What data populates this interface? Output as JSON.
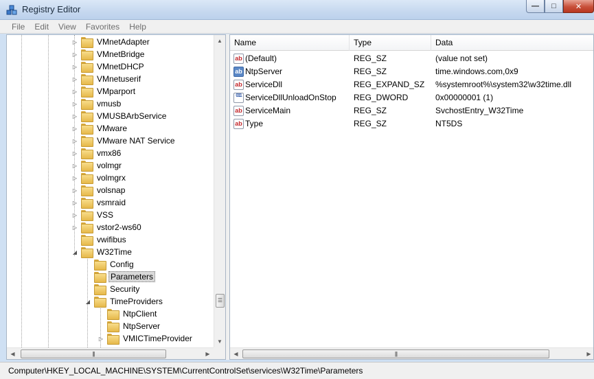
{
  "window": {
    "title": "Registry Editor",
    "buttons": {
      "minimize": "—",
      "maximize": "□",
      "close": "✕"
    }
  },
  "menu": [
    "File",
    "Edit",
    "View",
    "Favorites",
    "Help"
  ],
  "tree": {
    "items": [
      {
        "label": "VMnetAdapter",
        "expander": "▷"
      },
      {
        "label": "VMnetBridge",
        "expander": "▷"
      },
      {
        "label": "VMnetDHCP",
        "expander": "▷"
      },
      {
        "label": "VMnetuserif",
        "expander": "▷"
      },
      {
        "label": "VMparport",
        "expander": "▷"
      },
      {
        "label": "vmusb",
        "expander": "▷"
      },
      {
        "label": "VMUSBArbService",
        "expander": "▷"
      },
      {
        "label": "VMware",
        "expander": "▷"
      },
      {
        "label": "VMware NAT Service",
        "expander": "▷"
      },
      {
        "label": "vmx86",
        "expander": "▷"
      },
      {
        "label": "volmgr",
        "expander": "▷"
      },
      {
        "label": "volmgrx",
        "expander": "▷"
      },
      {
        "label": "volsnap",
        "expander": "▷"
      },
      {
        "label": "vsmraid",
        "expander": "▷"
      },
      {
        "label": "VSS",
        "expander": "▷"
      },
      {
        "label": "vstor2-ws60",
        "expander": "▷"
      },
      {
        "label": "vwifibus",
        "expander": ""
      },
      {
        "label": "W32Time",
        "expander": "◢"
      },
      {
        "label": "Config",
        "expander": ""
      },
      {
        "label": "Parameters",
        "expander": ""
      },
      {
        "label": "Security",
        "expander": ""
      },
      {
        "label": "TimeProviders",
        "expander": "◢"
      },
      {
        "label": "NtpClient",
        "expander": ""
      },
      {
        "label": "NtpServer",
        "expander": ""
      },
      {
        "label": "VMICTimeProvider",
        "expander": "▷"
      }
    ]
  },
  "list": {
    "columns": [
      "Name",
      "Type",
      "Data"
    ],
    "rows": [
      {
        "icon": "ab",
        "name": "(Default)",
        "type": "REG_SZ",
        "data": "(value not set)"
      },
      {
        "icon": "ab",
        "name": "NtpServer",
        "type": "REG_SZ",
        "data": "time.windows.com,0x9"
      },
      {
        "icon": "ab",
        "name": "ServiceDll",
        "type": "REG_EXPAND_SZ",
        "data": "%systemroot%\\system32\\w32time.dll"
      },
      {
        "icon": "011",
        "name": "ServiceDllUnloadOnStop",
        "type": "REG_DWORD",
        "data": "0x00000001 (1)"
      },
      {
        "icon": "ab",
        "name": "ServiceMain",
        "type": "REG_SZ",
        "data": "SvchostEntry_W32Time"
      },
      {
        "icon": "ab",
        "name": "Type",
        "type": "REG_SZ",
        "data": "NT5DS"
      }
    ]
  },
  "scroll": {
    "up": "▲",
    "down": "▼",
    "left": "◀",
    "right": "▶",
    "grip": "☰",
    "hgrip": "|||"
  },
  "statusbar": {
    "path": "Computer\\HKEY_LOCAL_MACHINE\\SYSTEM\\CurrentControlSet\\services\\W32Time\\Parameters"
  }
}
